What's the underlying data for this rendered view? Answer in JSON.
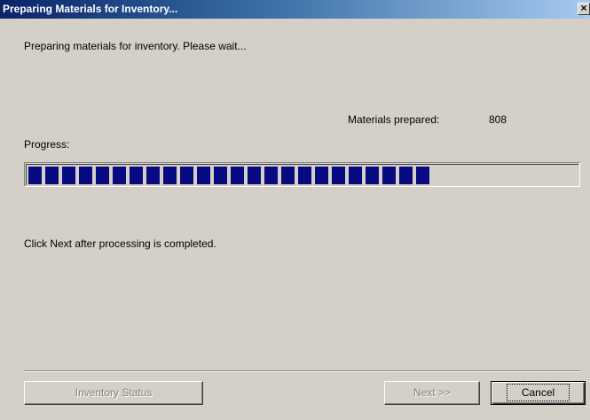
{
  "window": {
    "title": "Preparing Materials for Inventory...",
    "close_glyph": "×"
  },
  "status": {
    "message": "Preparing materials for inventory.  Please wait...",
    "count_label": "Materials prepared:",
    "count_value": "808"
  },
  "progress": {
    "label": "Progress:",
    "fraction": 0.74
  },
  "instructions": {
    "text": "Click Next after processing is completed."
  },
  "buttons": {
    "inventory_status": "Inventory Status",
    "next": "Next >>",
    "cancel": "Cancel"
  },
  "colors": {
    "progress_fill": "#0a0a80",
    "titlebar_start": "#0a246a",
    "titlebar_end": "#a6caf0",
    "dialog_background": "#d4d0c8"
  }
}
